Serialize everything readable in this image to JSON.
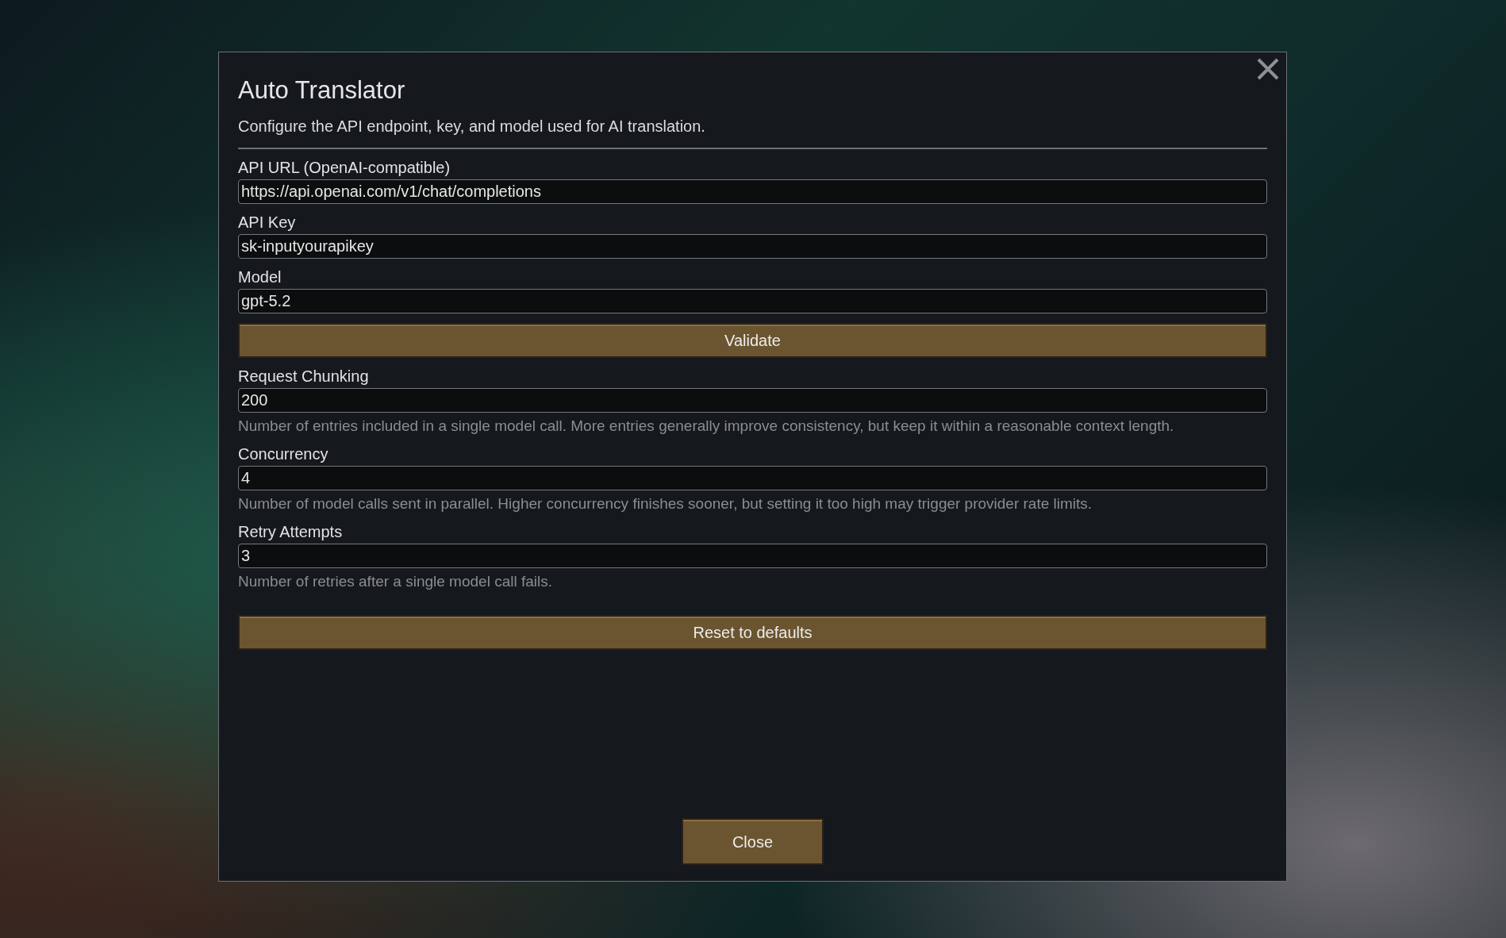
{
  "dialog": {
    "title": "Auto Translator",
    "description": "Configure the API endpoint, key, and model used for AI translation.",
    "items": [
      {
        "kind": "field",
        "label": "API URL (OpenAI-compatible)",
        "value": "https://api.openai.com/v1/chat/completions"
      },
      {
        "kind": "field",
        "label": "API Key",
        "value": "sk-inputyourapikey"
      },
      {
        "kind": "field",
        "label": "Model",
        "value": "gpt-5.2"
      },
      {
        "kind": "button",
        "label": "Validate"
      },
      {
        "kind": "field",
        "label": "Request Chunking",
        "value": "200",
        "help": "Number of entries included in a single model call. More entries generally improve consistency, but keep it within a reasonable context length."
      },
      {
        "kind": "field",
        "label": "Concurrency",
        "value": "4",
        "help": "Number of model calls sent in parallel. Higher concurrency finishes sooner, but setting it too high may trigger provider rate limits."
      },
      {
        "kind": "field",
        "label": "Retry Attempts",
        "value": "3",
        "help": "Number of retries after a single model call fails."
      },
      {
        "kind": "button",
        "label": "Reset to defaults"
      }
    ],
    "close_button": "Close"
  }
}
